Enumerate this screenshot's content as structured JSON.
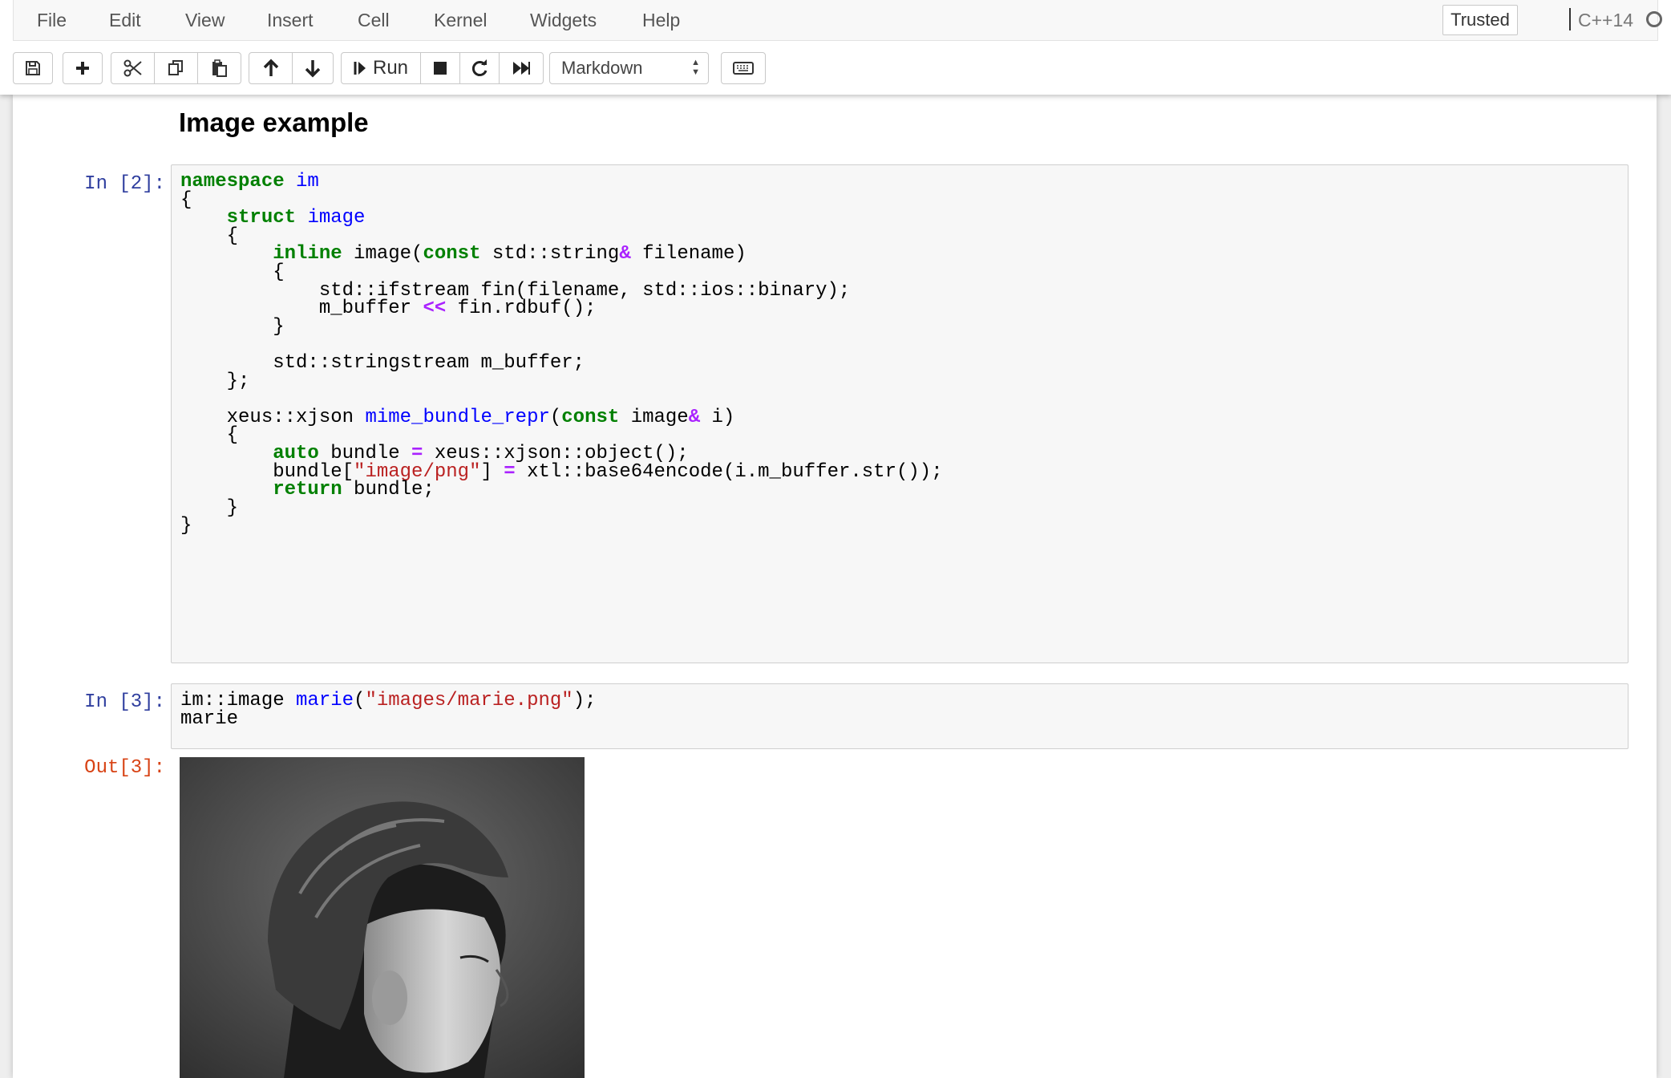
{
  "menu": [
    "File",
    "Edit",
    "View",
    "Insert",
    "Cell",
    "Kernel",
    "Widgets",
    "Help"
  ],
  "status": {
    "trusted": "Trusted",
    "kernel": "C++14"
  },
  "toolbar": {
    "icons": [
      "save-icon",
      "plus-icon",
      "scissors-icon",
      "copy-icon",
      "paste-icon",
      "arrow-up-icon",
      "arrow-down-icon",
      "run-icon",
      "stop-icon",
      "restart-icon",
      "fast-forward-icon",
      "keyboard-icon"
    ],
    "run_label": "Run",
    "cell_type": "Markdown"
  },
  "notebook": {
    "heading": "Image example",
    "cells": [
      {
        "prompt": "In [2]:",
        "lines": [
          [
            [
              "namespace",
              "kw"
            ],
            [
              " "
            ],
            [
              "im",
              "nm"
            ]
          ],
          [
            [
              "{"
            ]
          ],
          [
            [
              "    "
            ],
            [
              "struct",
              "kw"
            ],
            [
              " "
            ],
            [
              "image",
              "nm"
            ]
          ],
          [
            [
              "    {"
            ]
          ],
          [
            [
              "        "
            ],
            [
              "inline",
              "kw"
            ],
            [
              " image("
            ],
            [
              "const",
              "kw"
            ],
            [
              " std::string"
            ],
            [
              "&",
              "op"
            ],
            [
              " filename)"
            ]
          ],
          [
            [
              "        {"
            ]
          ],
          [
            [
              "            std::ifstream fin(filename, std::ios::binary);"
            ]
          ],
          [
            [
              "            m_buffer "
            ],
            [
              "<<",
              "op"
            ],
            [
              " fin.rdbuf();"
            ]
          ],
          [
            [
              "        }"
            ]
          ],
          [
            [
              ""
            ]
          ],
          [
            [
              "        std::stringstream m_buffer;"
            ]
          ],
          [
            [
              "    };"
            ]
          ],
          [
            [
              ""
            ]
          ],
          [
            [
              "    xeus::xjson "
            ],
            [
              "mime_bundle_repr",
              "nm"
            ],
            [
              "("
            ],
            [
              "const",
              "kw"
            ],
            [
              " image"
            ],
            [
              "&",
              "op"
            ],
            [
              " i)"
            ]
          ],
          [
            [
              "    {"
            ]
          ],
          [
            [
              "        "
            ],
            [
              "auto",
              "kw"
            ],
            [
              " bundle "
            ],
            [
              "=",
              "op"
            ],
            [
              " xeus::xjson::object();"
            ]
          ],
          [
            [
              "        bundle["
            ],
            [
              "\"image/png\"",
              "st"
            ],
            [
              "] "
            ],
            [
              "=",
              "op"
            ],
            [
              " xtl::base64encode(i.m_buffer.str());"
            ]
          ],
          [
            [
              "        "
            ],
            [
              "return",
              "kw"
            ],
            [
              " bundle;"
            ]
          ],
          [
            [
              "    }"
            ]
          ],
          [
            [
              "}"
            ]
          ]
        ]
      },
      {
        "prompt": "In [3]:",
        "lines": [
          [
            [
              "im::image "
            ],
            [
              "marie",
              "nm"
            ],
            [
              "("
            ],
            [
              "\"images/marie.png\"",
              "st"
            ],
            [
              ");"
            ]
          ],
          [
            [
              "marie"
            ]
          ]
        ]
      }
    ],
    "output_prompt": "Out[3]:"
  },
  "colors": {
    "keyword": "#008000",
    "name": "#0000ff",
    "operator": "#aa22ff",
    "string": "#ba2121",
    "prompt_in": "#303f9f",
    "prompt_out": "#d84315"
  }
}
